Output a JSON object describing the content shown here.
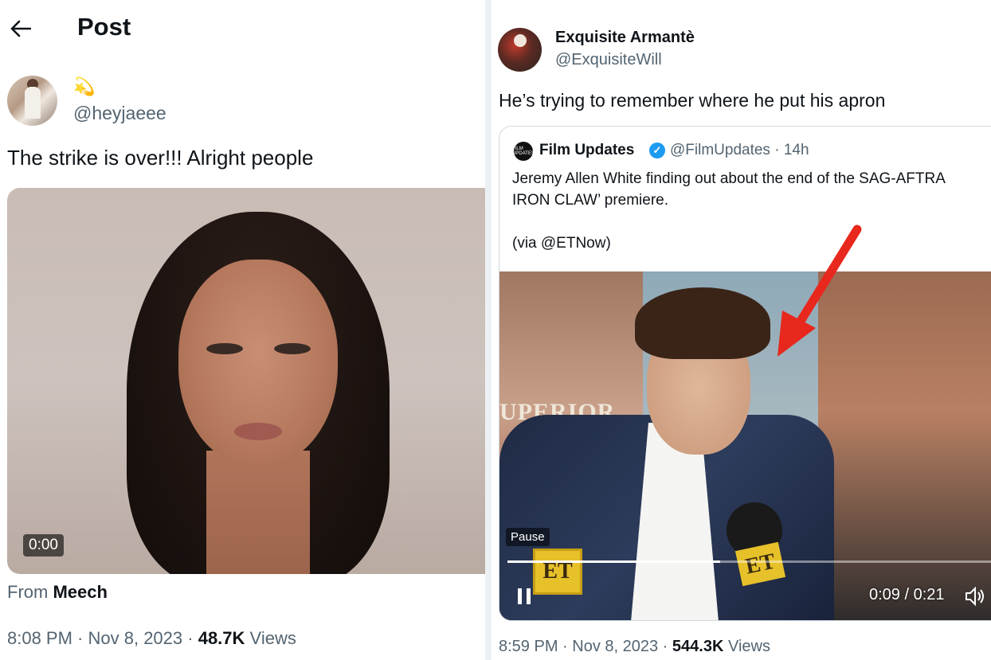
{
  "left_post": {
    "header_title": "Post",
    "author_name_emoji": "💫",
    "author_handle": "@heyjaeee",
    "text": "The strike is over!!! Alright people",
    "video_time": "0:00",
    "source_prefix": "From",
    "source_name": "Meech",
    "time": "8:08 PM",
    "date": "Nov 8, 2023",
    "views_count": "48.7K",
    "views_label": "Views"
  },
  "right_post": {
    "author_name": "Exquisite Armantè",
    "author_handle": "@ExquisiteWill",
    "text": "He’s trying to remember where he put his apron",
    "time": "8:59 PM",
    "date": "Nov 8, 2023",
    "views_count": "544.3K",
    "views_label": "Views",
    "quote": {
      "avatar_text": "FILM UPDATES",
      "author_name": "Film Updates",
      "verified": true,
      "author_handle": "@FilmUpdates",
      "age": "14h",
      "line1": "Jeremy Allen White finding out about the end of the SAG-AFTRA",
      "line2": "IRON CLAW’ premiere.",
      "line3": "(via @ETNow)",
      "video": {
        "pause_label": "Pause",
        "time_current": "0:09",
        "time_total": "0:21",
        "progress_fraction": 0.43,
        "shirt_text": "UPERIOR",
        "logo_text": "ET"
      }
    }
  },
  "colors": {
    "text_primary": "#0f1419",
    "text_secondary": "#536471",
    "verified_blue": "#1d9bf0",
    "arrow_red": "#e8271d",
    "et_yellow": "#e7c12a"
  },
  "icons": {
    "back": "arrow-left-icon",
    "verified": "verified-badge-icon",
    "pause": "pause-icon",
    "volume": "volume-icon",
    "annotation": "red-arrow"
  }
}
